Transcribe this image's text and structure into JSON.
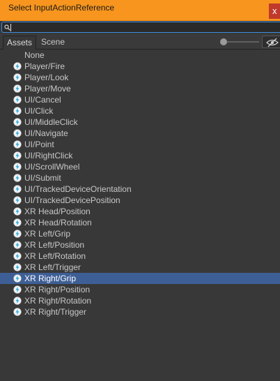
{
  "window": {
    "title": "Select InputActionReference",
    "close_label": "x"
  },
  "search": {
    "value": "",
    "placeholder": ""
  },
  "tabs": [
    {
      "label": "Assets",
      "active": true
    },
    {
      "label": "Scene",
      "active": false
    }
  ],
  "colors": {
    "titlebar": "#f7951e",
    "selection": "#3e5f96",
    "icon": "#1aa6e0",
    "background": "#383838"
  },
  "icons": {
    "item": "input-action-icon",
    "search": "search-icon",
    "visibility": "eye-hidden-icon"
  },
  "list": {
    "none_label": "None",
    "selected_index": 20,
    "items": [
      "Player/Fire",
      "Player/Look",
      "Player/Move",
      "UI/Cancel",
      "UI/Click",
      "UI/MiddleClick",
      "UI/Navigate",
      "UI/Point",
      "UI/RightClick",
      "UI/ScrollWheel",
      "UI/Submit",
      "UI/TrackedDeviceOrientation",
      "UI/TrackedDevicePosition",
      "XR Head/Position",
      "XR Head/Rotation",
      "XR Left/Grip",
      "XR Left/Position",
      "XR Left/Rotation",
      "XR Left/Trigger",
      "XR Right/Grip",
      "XR Right/Position",
      "XR Right/Rotation",
      "XR Right/Trigger"
    ]
  }
}
